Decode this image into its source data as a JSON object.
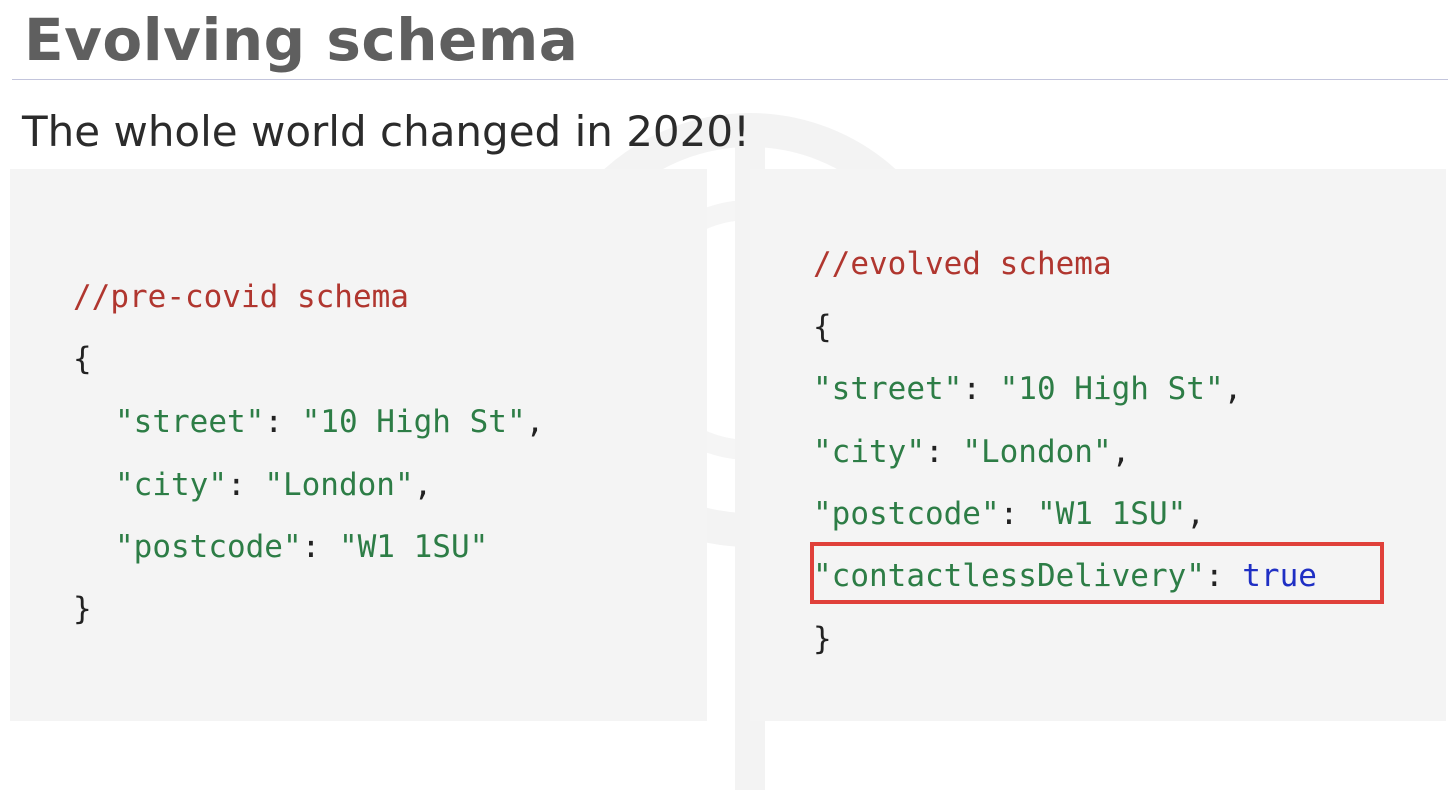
{
  "slide": {
    "title": "Evolving schema",
    "subtitle": "The whole world changed in 2020!"
  },
  "left_code": {
    "comment": "//pre-covid schema",
    "open_brace": "{",
    "fields": [
      {
        "key": "\"street\"",
        "sep": ": ",
        "value": "\"10 High St\"",
        "trail": ","
      },
      {
        "key": "\"city\"",
        "sep": ": ",
        "value": "\"London\"",
        "trail": ","
      },
      {
        "key": "\"postcode\"",
        "sep": ": ",
        "value": "\"W1 1SU\"",
        "trail": ""
      }
    ],
    "close_brace": "}"
  },
  "right_code": {
    "comment": "//evolved schema",
    "open_brace": "{",
    "fields": [
      {
        "key": "\"street\"",
        "sep": ": ",
        "value": "\"10 High St\"",
        "trail": ","
      },
      {
        "key": "\"city\"",
        "sep": ": ",
        "value": "\"London\"",
        "trail": ","
      },
      {
        "key": "\"postcode\"",
        "sep": ": ",
        "value": "\"W1 1SU\"",
        "trail": ","
      },
      {
        "key": "\"contactlessDelivery\"",
        "sep": ": ",
        "value": "true",
        "trail": ""
      }
    ],
    "close_brace": "}"
  },
  "colors": {
    "comment": "#b0362f",
    "string": "#2d7d46",
    "boolean": "#1f2fc4",
    "highlight_border": "#e0403a",
    "panel_background": "#f4f4f4",
    "title": "#5f5f5f"
  },
  "icons": {
    "watermark": "faint-circular-logo-watermark"
  }
}
